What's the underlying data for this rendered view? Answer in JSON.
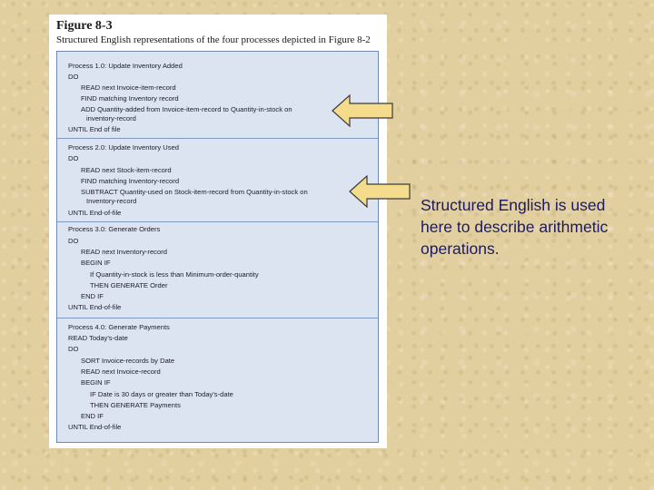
{
  "figure": {
    "title": "Figure 8-3",
    "subtitle": "Structured English representations of the four processes depicted in Figure 8-2"
  },
  "processes": [
    {
      "lines": [
        "Process 1.0: Update Inventory Added",
        "DO",
        "READ next Invoice-item-record",
        "FIND matching Inventory record",
        "ADD Quantity-added from Invoice-item-record to Quantity-in-stock on",
        "inventory-record",
        "UNTIL End of file"
      ]
    },
    {
      "lines": [
        "Process 2.0: Update Inventory Used",
        "DO",
        "READ next Stock-item-record",
        "FIND matching Inventory-record",
        "SUBTRACT Quantity-used on Stock-item-record from Quantity-in-stock on",
        "Inventory-record",
        "UNTIL End-of-file"
      ]
    },
    {
      "lines": [
        "Process 3.0: Generate Orders",
        "DO",
        "READ next Inventory-record",
        "BEGIN IF",
        "If Quantity-in-stock is less than Minimum-order-quantity",
        "THEN GENERATE Order",
        "END IF",
        "UNTIL End-of-file"
      ]
    },
    {
      "lines": [
        "Process 4.0: Generate Payments",
        "READ Today's-date",
        "DO",
        "SORT Invoice-records by Date",
        "READ next Invoice-record",
        "BEGIN IF",
        "IF Date is 30 days or greater than Today's-date",
        "THEN GENERATE Payments",
        "END IF",
        "UNTIL End-of-file"
      ]
    }
  ],
  "caption": "Structured English is used here to describe arithmetic operations.",
  "colors": {
    "arrow_fill": "#f4dc8c",
    "arrow_stroke": "#3a3a3a",
    "caption_text": "#1a1a66",
    "process_box_bg": "#dbe4f0"
  },
  "icons": [
    "left-arrow-icon",
    "left-arrow-icon"
  ]
}
